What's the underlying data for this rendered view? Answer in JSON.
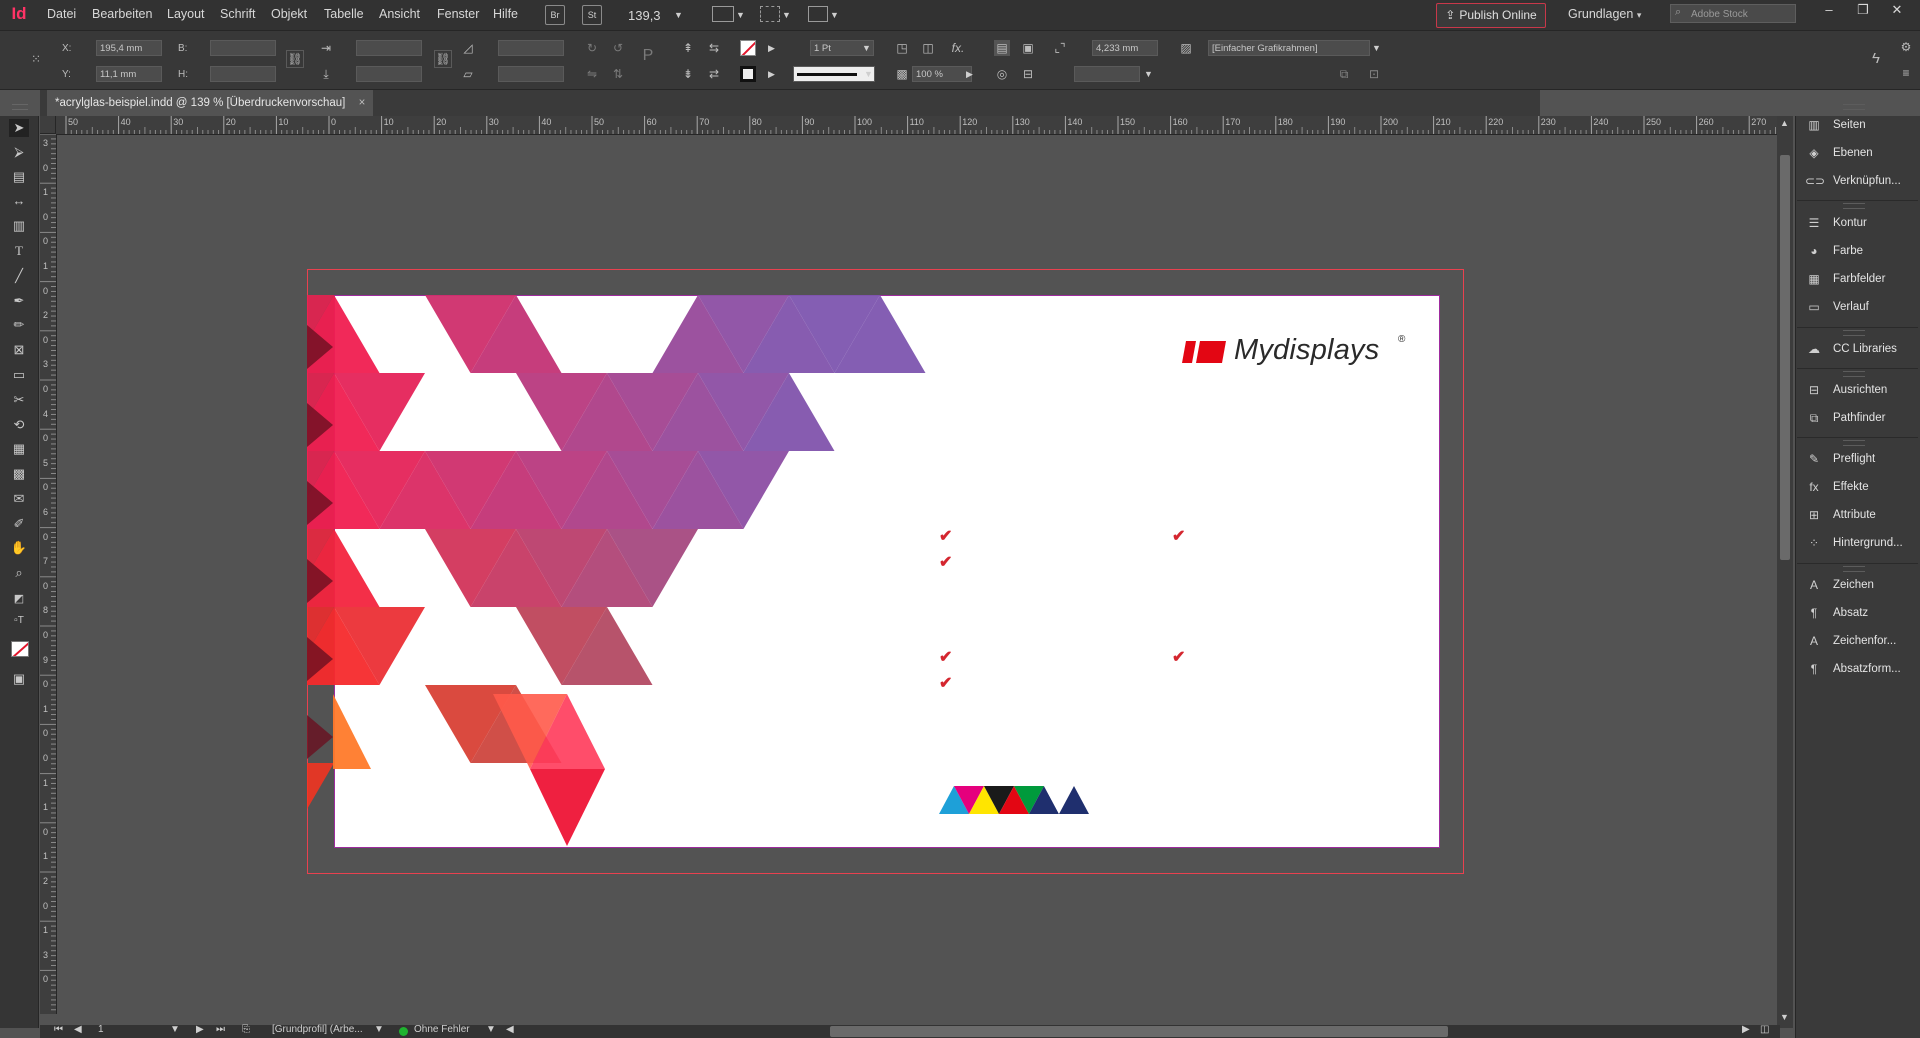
{
  "app": {
    "logo": "Id"
  },
  "menu": [
    "Datei",
    "Bearbeiten",
    "Layout",
    "Schrift",
    "Objekt",
    "Tabelle",
    "Ansicht",
    "Fenster",
    "Hilfe"
  ],
  "menubar": {
    "bridge": "Br",
    "stock": "St",
    "zoom": "139,3",
    "publish": "Publish Online",
    "workspace": "Grundlagen",
    "search_placeholder": "Adobe Stock",
    "window_buttons": [
      "–",
      "❐",
      "✕"
    ]
  },
  "control": {
    "x_label": "X:",
    "x_value": "195,4 mm",
    "y_label": "Y:",
    "y_value": "11,1 mm",
    "w_label": "B:",
    "h_label": "H:",
    "stroke_weight": "1 Pt",
    "opacity": "100 %",
    "offset": "4,233 mm",
    "object_style": "[Einfacher Grafikrahmen]"
  },
  "document": {
    "tab_title": "*acrylglas-beispiel.indd @ 139 % [Überdruckenvorschau]",
    "close": "×"
  },
  "ruler": {
    "h_ticks": [
      "50",
      "40",
      "30",
      "20",
      "10",
      "0",
      "10",
      "20",
      "30",
      "40",
      "50",
      "60",
      "70",
      "80",
      "90",
      "100",
      "110",
      "120",
      "130",
      "140",
      "150",
      "160",
      "170",
      "180",
      "190",
      "200",
      "210",
      "220",
      "230",
      "240",
      "250",
      "260",
      "270"
    ],
    "v_ticks": [
      "3",
      "0",
      "1",
      "0",
      "0",
      "1",
      "0",
      "2",
      "0",
      "3",
      "0",
      "4",
      "0",
      "5",
      "0",
      "6",
      "0",
      "7",
      "0",
      "8",
      "0",
      "9",
      "0",
      "1",
      "0",
      "0",
      "1",
      "1",
      "0",
      "1",
      "2",
      "0",
      "1",
      "3",
      "0"
    ]
  },
  "canvas": {
    "brand_name": "Mydisplays",
    "brand_mark": "®",
    "check_glyph": "✔",
    "brand_colors": {
      "red": "#e30613",
      "black": "#1a1a1a",
      "cyan": "#1ea0d8",
      "magenta": "#e5007d",
      "yellow": "#ffe500",
      "green": "#009a3c",
      "navy": "#1f2f6e"
    }
  },
  "panels": [
    {
      "icon": "pages-icon",
      "glyph": "▥",
      "label": "Seiten"
    },
    {
      "icon": "layers-icon",
      "glyph": "◈",
      "label": "Ebenen"
    },
    {
      "icon": "links-icon",
      "glyph": "⊂⊃",
      "label": "Verknüpfun..."
    },
    {
      "icon": "stroke-icon",
      "glyph": "☰",
      "label": "Kontur"
    },
    {
      "icon": "color-icon",
      "glyph": "◕",
      "label": "Farbe"
    },
    {
      "icon": "swatches-icon",
      "glyph": "▦",
      "label": "Farbfelder"
    },
    {
      "icon": "gradient-icon",
      "glyph": "▭",
      "label": "Verlauf"
    },
    {
      "icon": "cc-libraries-icon",
      "glyph": "☁",
      "label": "CC Libraries"
    },
    {
      "icon": "align-icon",
      "glyph": "⊟",
      "label": "Ausrichten"
    },
    {
      "icon": "pathfinder-icon",
      "glyph": "⧉",
      "label": "Pathfinder"
    },
    {
      "icon": "preflight-icon",
      "glyph": "✎",
      "label": "Preflight"
    },
    {
      "icon": "effects-icon",
      "glyph": "fx",
      "label": "Effekte"
    },
    {
      "icon": "attributes-icon",
      "glyph": "⊞",
      "label": "Attribute"
    },
    {
      "icon": "background-tasks-icon",
      "glyph": "⁘",
      "label": "Hintergrund..."
    },
    {
      "icon": "character-icon",
      "glyph": "A",
      "label": "Zeichen"
    },
    {
      "icon": "paragraph-icon",
      "glyph": "¶",
      "label": "Absatz"
    },
    {
      "icon": "character-styles-icon",
      "glyph": "A",
      "label": "Zeichenfor..."
    },
    {
      "icon": "paragraph-styles-icon",
      "glyph": "¶",
      "label": "Absatzform..."
    }
  ],
  "status": {
    "page": "1",
    "profile": "[Grundprofil] (Arbe...",
    "errors": "Ohne Fehler"
  }
}
